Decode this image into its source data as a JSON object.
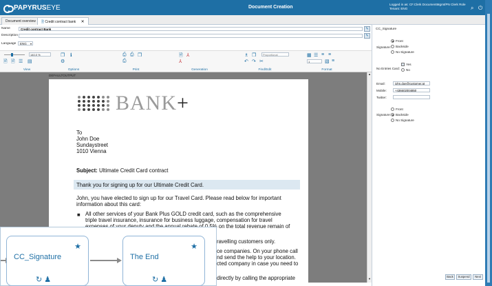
{
  "app": {
    "logo_bold": "PAPYRUS",
    "logo_thin": "EYE",
    "title": "Document Creation",
    "user_line1": "Logged in as: CF.Clerk  DocumentMgmt/PN Clerk Role",
    "user_line2": "Tenant: ENG"
  },
  "tabs": [
    {
      "label": "Document overview"
    },
    {
      "label": "Credit contract bank"
    }
  ],
  "form": {
    "name_label": "Name",
    "name_value": "Credit contract Bank",
    "description_label": "Description",
    "language_label": "Language",
    "language_value": "ENG"
  },
  "ribbon": {
    "zoom_value": "140.0 %",
    "font_value": "Proportional",
    "size_value": "1",
    "groups": [
      "View",
      "Options",
      "Print",
      "Generation",
      "Find/Edit",
      "Format"
    ]
  },
  "editor": {
    "page_tag": "DEFAULTOUTPUT",
    "bank_word": "BANK",
    "bank_plus": "+",
    "address": [
      "To",
      "John Doe",
      "Sundaystreet",
      "1010 Vienna"
    ],
    "subject_label": "Subject:",
    "subject_value": "Ultimate Credit Card contract",
    "thanks": "Thank you for signing up for our Ultimate Credit Card.",
    "para1_l1": "John, you have elected to sign up for our Travel Card. Please read below for important",
    "para1_l2": "information about this card:",
    "bullet1_l1": "All other services of your Bank Plus GOLD credit card, such as the comprehensive",
    "bullet1_l2": "triple travel insurance, insurance for business luggage, compensation for travel",
    "bullet1_l3": "expenses of your deputy and the annual rebate of 0.5% on the total revenue remain of",
    "frag1": "ravelling customers only.",
    "frag2": "ce companies. On your phone call",
    "frag3": "nd send the help to your location.",
    "frag4": "cted company in case you need to",
    "frag5": "directly by calling the appropriate"
  },
  "panel": {
    "title": "CC_Signature",
    "sig1_label": "Signature:",
    "sig1_options": [
      "Front",
      "Backside",
      "No Signature"
    ],
    "sig1_selected": 0,
    "no_entries_label": "No Entries Card:",
    "no_entries_options": [
      "Yes",
      "No"
    ],
    "email_label": "Email:",
    "email_value": "john.doe@customer.at",
    "mobile_label": "Mobile:",
    "mobile_value": "+436602004850",
    "twitter_label": "Twitter:",
    "twitter_value": "",
    "sig2_label": "Signature:",
    "sig2_options": [
      "Front",
      "Backside",
      "No Signature"
    ],
    "sig2_selected": 1,
    "buttons": [
      "Back",
      "Suspend",
      "Next"
    ]
  },
  "workflow": {
    "nodes": [
      {
        "label": "CC_Signature"
      },
      {
        "label": "The End"
      }
    ]
  },
  "colors": {
    "brand_blue": "#1e6fa5",
    "highlight": "#dce8f1",
    "editor_bg": "#7d7d7d"
  },
  "icons": [
    "papyrus-logo-icon",
    "search-icon",
    "power-icon",
    "close-icon",
    "edit-icon",
    "print-icon",
    "generation-icon",
    "find-icon",
    "format-icon",
    "star-icon",
    "user-icon"
  ]
}
